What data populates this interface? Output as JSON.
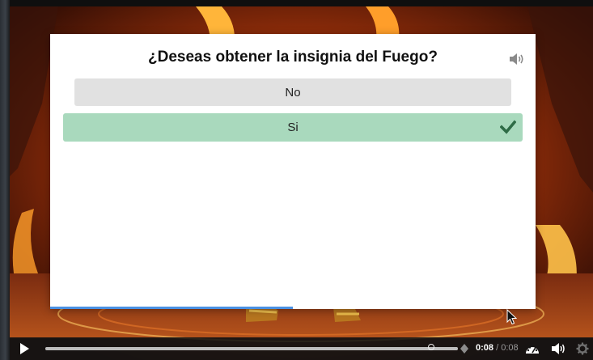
{
  "quiz": {
    "question": "¿Deseas obtener la insignia del Fuego?",
    "answers": [
      {
        "label": "No",
        "state": "default"
      },
      {
        "label": "Si",
        "state": "correct"
      }
    ],
    "audio_icon": "speaker-icon",
    "correct_icon": "check-icon",
    "colors": {
      "correct_bg": "#a9d9bd",
      "default_bg": "#e1e1e1",
      "check": "#2e6b46",
      "progress": "#4a90e2"
    }
  },
  "player": {
    "current_time": "0:08",
    "separator": "/",
    "duration": "0:08",
    "icons": [
      "play-icon",
      "marker-icon",
      "speed-icon",
      "volume-icon",
      "settings-icon"
    ]
  }
}
